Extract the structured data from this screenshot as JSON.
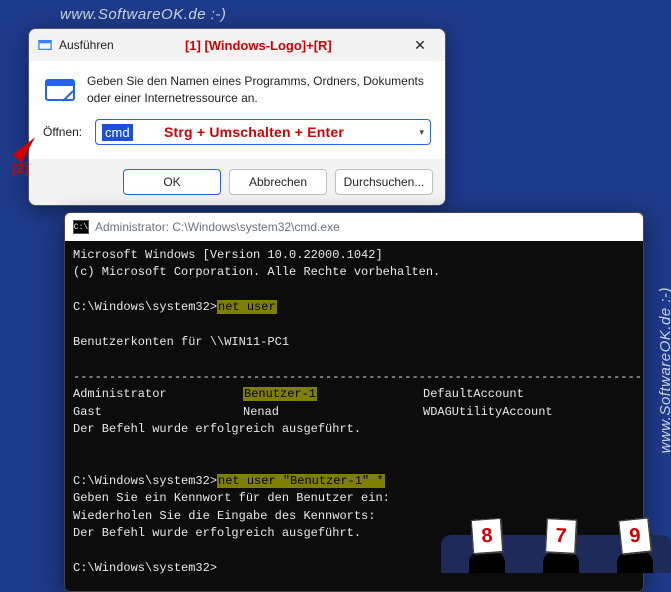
{
  "watermark": "www.SoftwareOK.de :-)",
  "annotations": {
    "logo_r": "[1] [Windows-Logo]+[R]",
    "hint": "Strg + Umschalten + Enter",
    "label2": "[2]"
  },
  "run": {
    "title": "Ausführen",
    "desc": "Geben Sie den Namen eines Programms, Ordners, Dokuments oder einer Internetressource an.",
    "label": "Öffnen:",
    "value": "cmd",
    "ok": "OK",
    "cancel": "Abbrechen",
    "browse": "Durchsuchen..."
  },
  "cmd": {
    "title": "Administrator: C:\\Windows\\system32\\cmd.exe",
    "line_version": "Microsoft Windows [Version 10.0.22000.1042]",
    "line_copy": "(c) Microsoft Corporation. Alle Rechte vorbehalten.",
    "prompt": "C:\\Windows\\system32>",
    "cmd1": "net user",
    "accounts_for": "Benutzerkonten für \\\\WIN11-PC1",
    "sep": "-------------------------------------------------------------------------------",
    "row1": {
      "c1": "Administrator",
      "c2": "Benutzer-1",
      "c3": "DefaultAccount"
    },
    "row2": {
      "c1": "Gast",
      "c2": "Nenad",
      "c3": "WDAGUtilityAccount"
    },
    "success": "Der Befehl wurde erfolgreich ausgeführt.",
    "cmd2": "net user \"Benutzer-1\" *",
    "pw1": "Geben Sie ein Kennwort für den Benutzer ein:",
    "pw2": "Wiederholen Sie die Eingabe des Kennworts:"
  },
  "judges": [
    "8",
    "7",
    "9"
  ]
}
